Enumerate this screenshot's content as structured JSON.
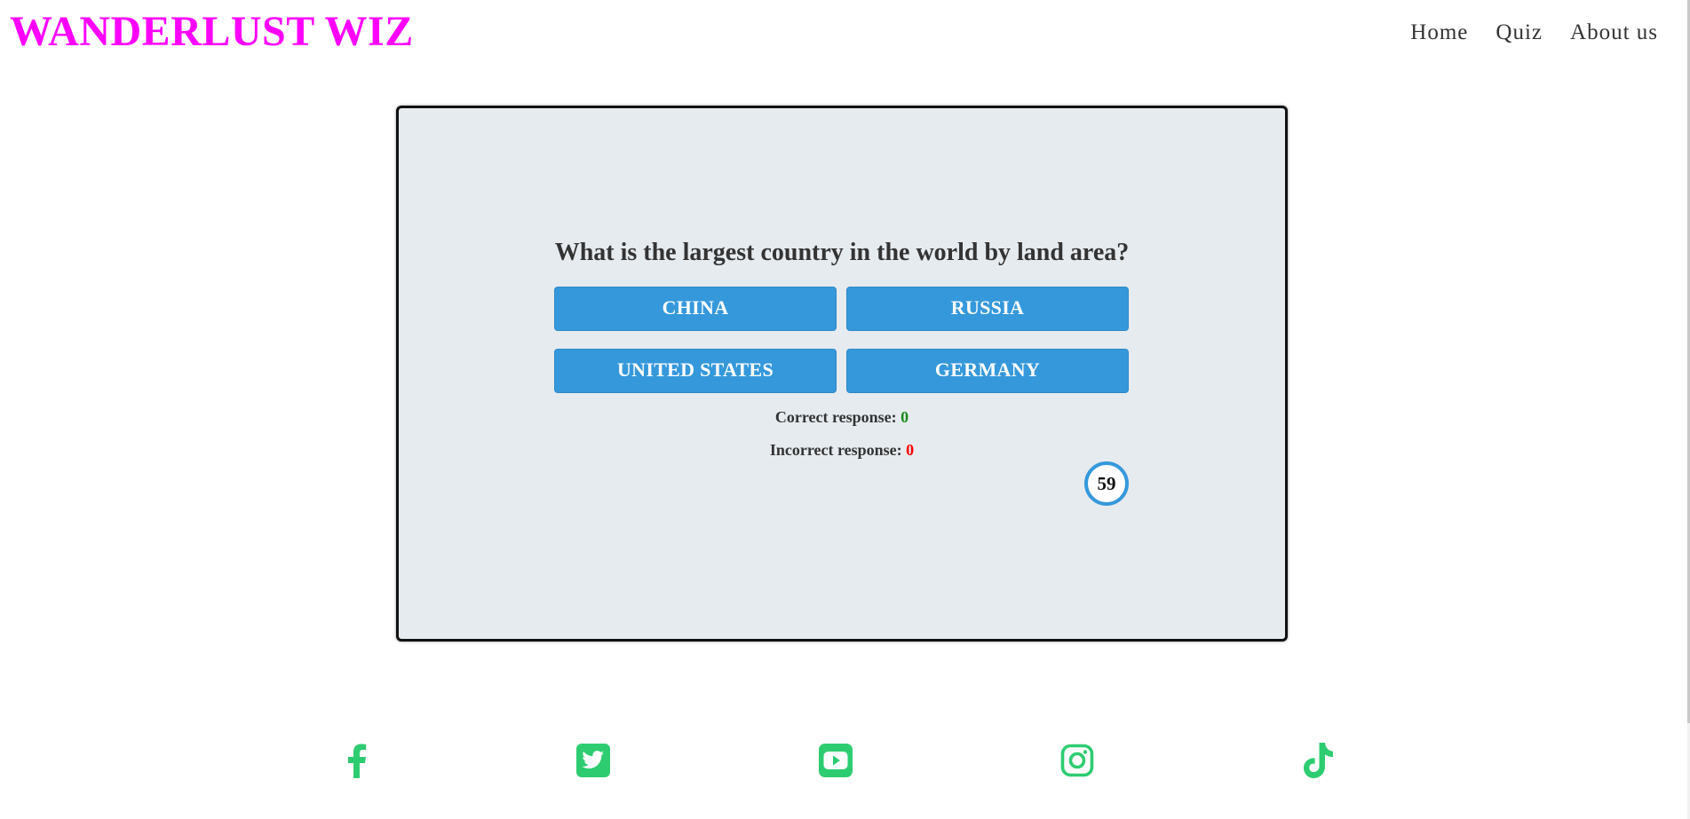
{
  "header": {
    "logo": "WANDERLUST WIZ",
    "nav": [
      {
        "label": "Home"
      },
      {
        "label": "Quiz"
      },
      {
        "label": "About us"
      }
    ]
  },
  "quiz": {
    "question": "What is the largest country in the world by land area?",
    "answers": [
      "CHINA",
      "RUSSIA",
      "UNITED STATES",
      "GERMANY"
    ],
    "correct_label": "Correct response:",
    "correct_value": "0",
    "incorrect_label": "Incorrect response:",
    "incorrect_value": "0",
    "timer": "59"
  },
  "footer": {
    "social_icons": [
      "facebook-icon",
      "twitter-icon",
      "youtube-icon",
      "instagram-icon",
      "tiktok-icon"
    ]
  },
  "colors": {
    "logo": "#ff00ff",
    "button": "#3598db",
    "social": "#2ecc71",
    "card_background": "#e6ebef",
    "correct": "#1a8a1a",
    "incorrect": "#ff0000"
  }
}
